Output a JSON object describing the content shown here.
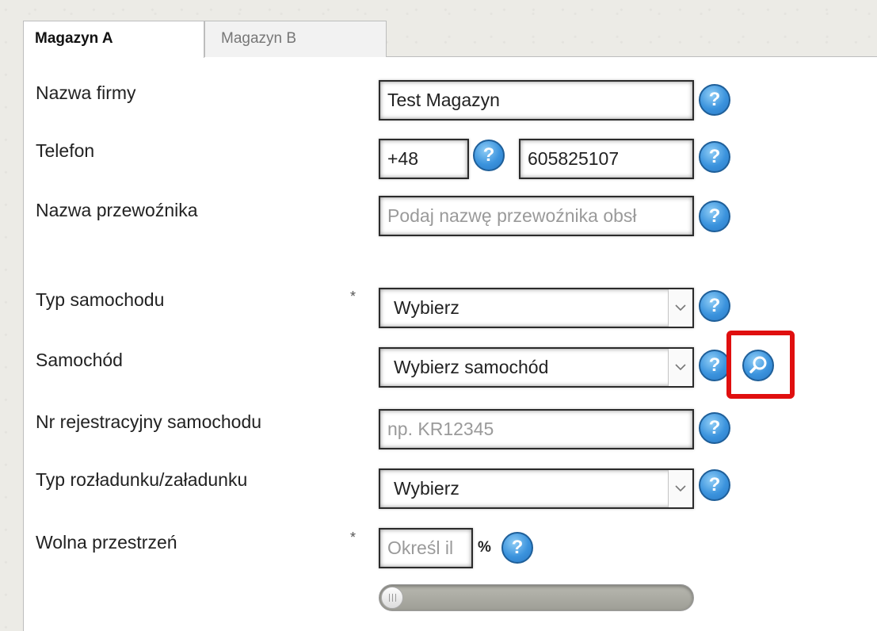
{
  "tabs": [
    {
      "label": "Magazyn A",
      "active": true
    },
    {
      "label": "Magazyn B",
      "active": false
    }
  ],
  "help_glyph": "?",
  "required_mark": "*",
  "form": {
    "company_name": {
      "label": "Nazwa firmy",
      "value": "Test Magazyn"
    },
    "phone": {
      "label": "Telefon",
      "prefix": "+48",
      "number": "605825107"
    },
    "carrier_name": {
      "label": "Nazwa przewoźnika",
      "placeholder": "Podaj nazwę przewoźnika obsł"
    },
    "vehicle_type": {
      "label": "Typ samochodu",
      "selected": "Wybierz",
      "required": true
    },
    "vehicle": {
      "label": "Samochód",
      "selected": "Wybierz samochód"
    },
    "registration": {
      "label": "Nr rejestracyjny samochodu",
      "placeholder": "np. KR12345"
    },
    "unloading_type": {
      "label": "Typ rozładunku/załadunku",
      "selected": "Wybierz"
    },
    "free_space": {
      "label": "Wolna przestrzeń",
      "placeholder": "Określ il",
      "unit": "%",
      "required": true,
      "slider_value": 0
    }
  },
  "icons": {
    "help": "question-mark-circle-icon",
    "search": "magnifier-icon",
    "dropdown": "chevron-down-icon"
  },
  "colors": {
    "help_button": "#3b93dd",
    "highlight": "#e00f0f",
    "placeholder": "#9a9a9a"
  }
}
